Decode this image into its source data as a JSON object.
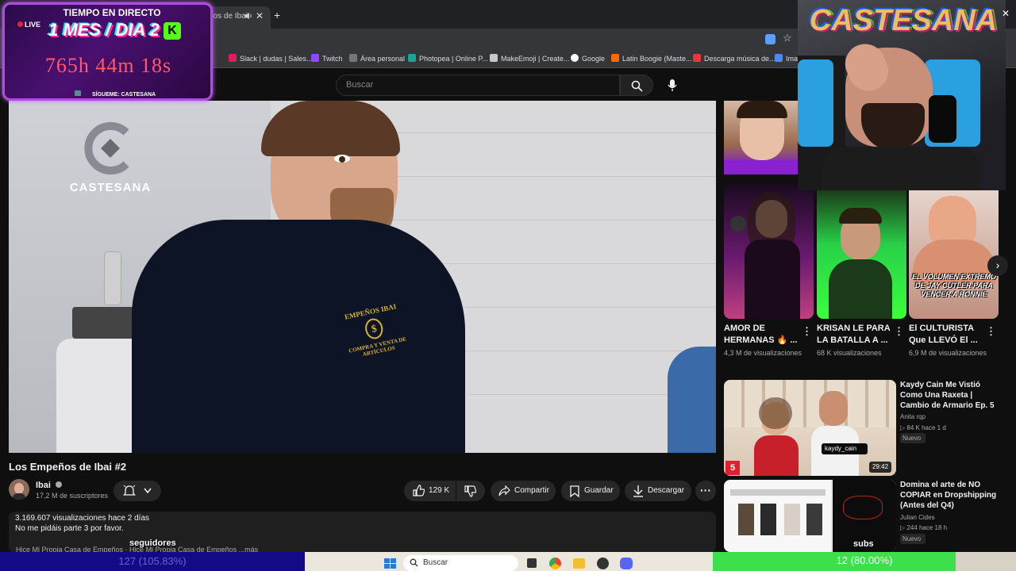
{
  "browser": {
    "tab_title": "ños de Ibai",
    "bookmarks": [
      "Slack | dudas | Sales...",
      "Twitch",
      "Área personal",
      "Photopea | Online P...",
      "MakeEmoji | Create...",
      "Google",
      "Latin Boogie (Maste...",
      "Descarga música de...",
      "Ima"
    ]
  },
  "youtube": {
    "search_placeholder": "Buscar"
  },
  "player": {
    "watermark": "CASTESANA",
    "shirt_text": "EMPEÑOS IBAI",
    "shirt_sub": "COMPRA Y VENTA DE ARTÍCULOS"
  },
  "video": {
    "title": "Los Empeños de Ibai #2",
    "channel": "Ibai",
    "subscribers": "17,2 M de suscriptores",
    "likes": "129 K",
    "share": "Compartir",
    "save": "Guardar",
    "download": "Descargar",
    "stats": "3.169.607 visualizaciones  hace 2 días",
    "description": "No me pidáis parte 3 por favor.",
    "desc_more": "Hice Mi Propia Casa de Empeños  ·  Hice Mi Propia Casa de Empeños  ...más"
  },
  "shorts": [
    {
      "title": "AMOR DE HERMANAS 🔥 ...",
      "views": "4,3 M de visualizaciones"
    },
    {
      "title": "KRISAN LE PARA LA BATALLA A ...",
      "views": "68 K visualizaciones"
    },
    {
      "title": "El CULTURISTA Que LLEVÓ El ...",
      "views": "6,9 M de visualizaciones",
      "thumb_text": "EL VOLUMEN EXTREMO DE JAY CUTLER PARA VENCER A RONNIE"
    }
  ],
  "recommended": [
    {
      "title": "Kaydy Cain Me Vistió Como Una Raxeta | Cambio de Armario Ep. 5",
      "channel": "Anita rqp",
      "views": "84 K",
      "age": "hace 1 d",
      "badge": "Nuevo",
      "duration": "29:42",
      "overlay": "kaydy_cain",
      "corner": "5"
    },
    {
      "title": "Domina el arte de NO COPIAR en Dropshipping (Antes del Q4)",
      "channel": "Julian Cides",
      "views": "244",
      "age": "hace 18 h",
      "badge": "Nuevo"
    }
  ],
  "overlay": {
    "live": "LIVE",
    "header": "TIEMPO EN DIRECTO",
    "day": "1 MES / DIA 2",
    "timer": "765h 44m 18s",
    "follow": "SÍGUEME: CASTESANA",
    "cam_logo": "CASTESANA",
    "seguidores": "seguidores",
    "subs": "subs"
  },
  "bottom": {
    "left_progress_text": "127 (105.83%)",
    "right_progress_text": "12 (80.00%)",
    "right_progress_fraction": 0.8,
    "taskbar_search": "Buscar"
  },
  "colors": {
    "accent_live": "#e5203a",
    "overlay_border": "#b04ce0",
    "progress_green": "#3de04a",
    "progress_blue": "#140a88"
  }
}
